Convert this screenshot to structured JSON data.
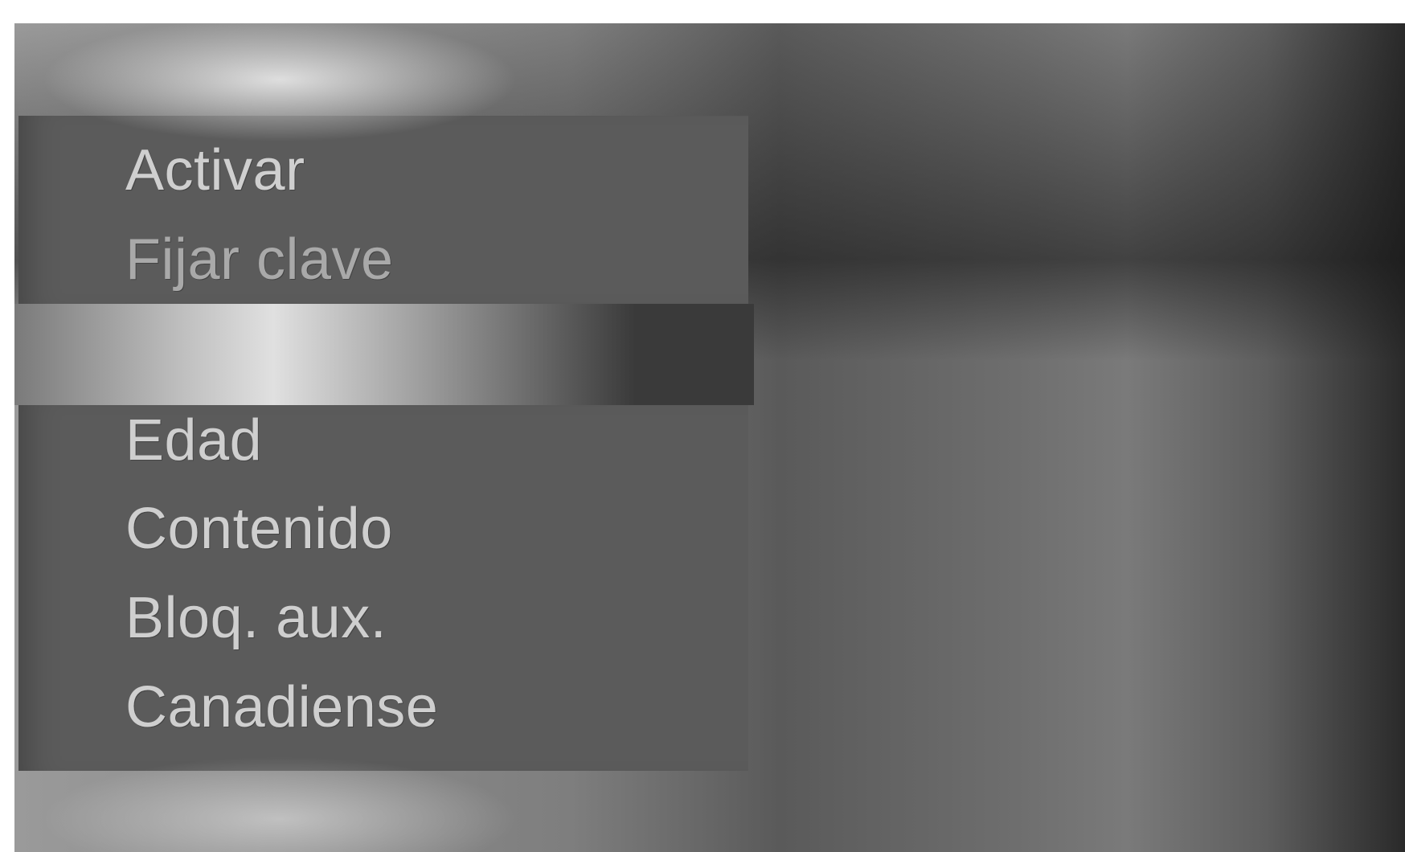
{
  "menu": {
    "top_items": [
      {
        "label": "Activar"
      },
      {
        "label": "Fijar clave"
      }
    ],
    "bottom_items": [
      {
        "label": "Edad"
      },
      {
        "label": "Contenido"
      },
      {
        "label": "Bloq. aux."
      },
      {
        "label": "Canadiense"
      }
    ]
  }
}
